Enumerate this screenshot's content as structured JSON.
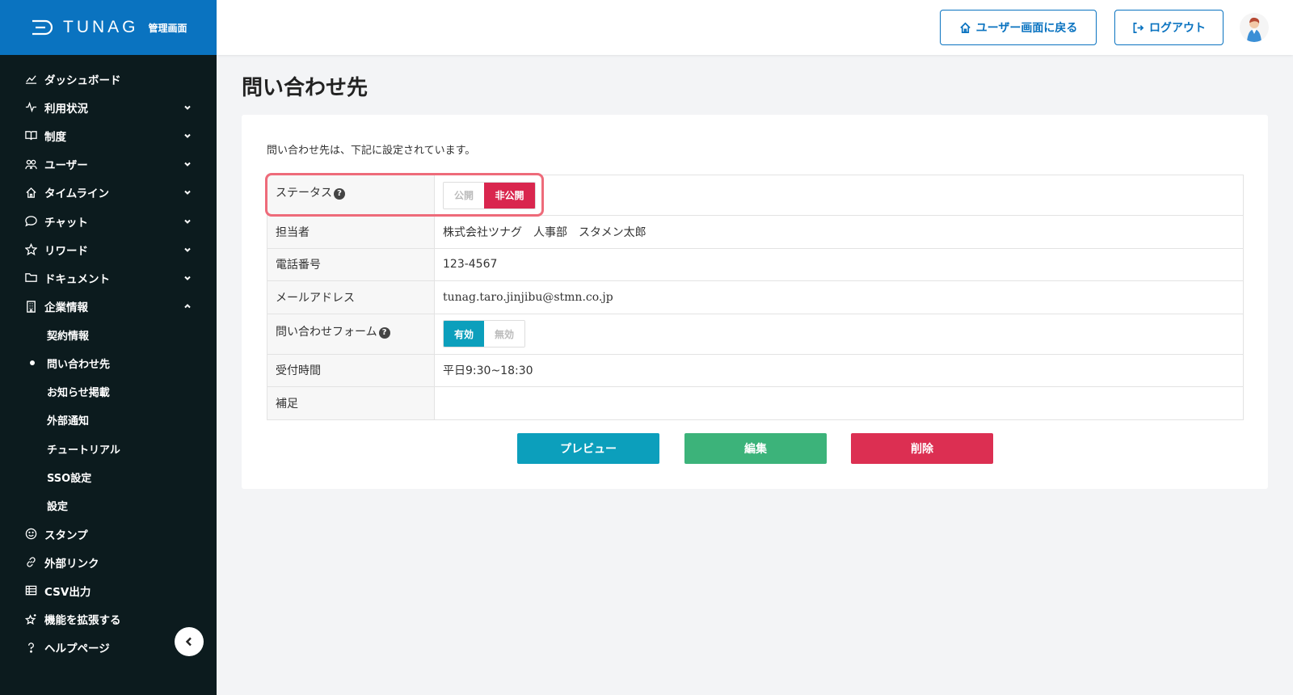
{
  "brand": {
    "name": "TUNAG",
    "subtitle": "管理画面",
    "color": "#0a73c0"
  },
  "sidebar": {
    "items": [
      {
        "label": "ダッシュボード",
        "icon": "chart-line-icon",
        "chevron": ""
      },
      {
        "label": "利用状況",
        "icon": "activity-icon",
        "chevron": "down"
      },
      {
        "label": "制度",
        "icon": "book-icon",
        "chevron": "down"
      },
      {
        "label": "ユーザー",
        "icon": "users-icon",
        "chevron": "down"
      },
      {
        "label": "タイムライン",
        "icon": "home-icon",
        "chevron": "down"
      },
      {
        "label": "チャット",
        "icon": "chat-icon",
        "chevron": "down"
      },
      {
        "label": "リワード",
        "icon": "star-icon",
        "chevron": "down"
      },
      {
        "label": "ドキュメント",
        "icon": "folder-icon",
        "chevron": "down"
      },
      {
        "label": "企業情報",
        "icon": "building-icon",
        "chevron": "up"
      }
    ],
    "subitems": [
      {
        "label": "契約情報",
        "active": false
      },
      {
        "label": "問い合わせ先",
        "active": true
      },
      {
        "label": "お知らせ掲載",
        "active": false
      },
      {
        "label": "外部通知",
        "active": false
      },
      {
        "label": "チュートリアル",
        "active": false
      },
      {
        "label": "SSO設定",
        "active": false
      },
      {
        "label": "設定",
        "active": false
      }
    ],
    "bottom_items": [
      {
        "label": "スタンプ",
        "icon": "smile-icon"
      },
      {
        "label": "外部リンク",
        "icon": "link-icon"
      },
      {
        "label": "CSV出力",
        "icon": "table-icon"
      },
      {
        "label": "機能を拡張する",
        "icon": "star-plus-icon"
      },
      {
        "label": "ヘルプページ",
        "icon": "help-icon"
      }
    ]
  },
  "header": {
    "back_label": "ユーザー画面に戻る",
    "logout_label": "ログアウト"
  },
  "main": {
    "title": "問い合わせ先",
    "intro": "問い合わせ先は、下記に設定されています。",
    "rows": {
      "status": {
        "label": "ステータス",
        "options": [
          "公開",
          "非公開"
        ],
        "selected": "非公開"
      },
      "person": {
        "label": "担当者",
        "value": "株式会社ツナグ　人事部　スタメン太郎"
      },
      "phone": {
        "label": "電話番号",
        "value": "123-4567"
      },
      "email": {
        "label": "メールアドレス",
        "value": "tunag.taro.jinjibu@stmn.co.jp"
      },
      "form": {
        "label": "問い合わせフォーム",
        "options": [
          "有効",
          "無効"
        ],
        "selected": "有効"
      },
      "hours": {
        "label": "受付時間",
        "value": "平日9:30~18:30"
      },
      "note": {
        "label": "補足",
        "value": ""
      }
    },
    "actions": {
      "preview": "プレビュー",
      "edit": "編集",
      "delete": "削除"
    }
  },
  "colors": {
    "sidebar_bg": "#0c1b1e",
    "danger": "#dc2f52",
    "success": "#3cb37a",
    "info": "#0c9fbc"
  }
}
